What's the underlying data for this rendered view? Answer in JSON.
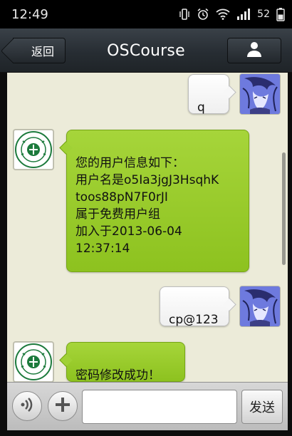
{
  "status_bar": {
    "time": "12:49",
    "battery": "52"
  },
  "header": {
    "back_label": "返回",
    "title": "OSCourse",
    "profile_icon": "person-icon"
  },
  "messages": [
    {
      "direction": "out",
      "sender": "user",
      "text": "q"
    },
    {
      "direction": "in",
      "sender": "bot",
      "text": "您的用户信息如下：\n用户名是o5Ia3jgJ3HsqhK\ntoos88pN7F0rJI\n属于免费用户组\n加入于2013-06-04\n12:37:14"
    },
    {
      "direction": "out",
      "sender": "user",
      "text": "cp@123"
    },
    {
      "direction": "in",
      "sender": "bot",
      "text": "密码修改成功！"
    }
  ],
  "input_bar": {
    "voice_icon": "voice-icon",
    "plus_icon": "plus-icon",
    "input_value": "",
    "send_label": "发送"
  },
  "colors": {
    "chat_background": "#ecebd9",
    "incoming_bubble": "#9acd2c",
    "outgoing_bubble": "#ffffff",
    "title_bar": "#2b3137"
  }
}
